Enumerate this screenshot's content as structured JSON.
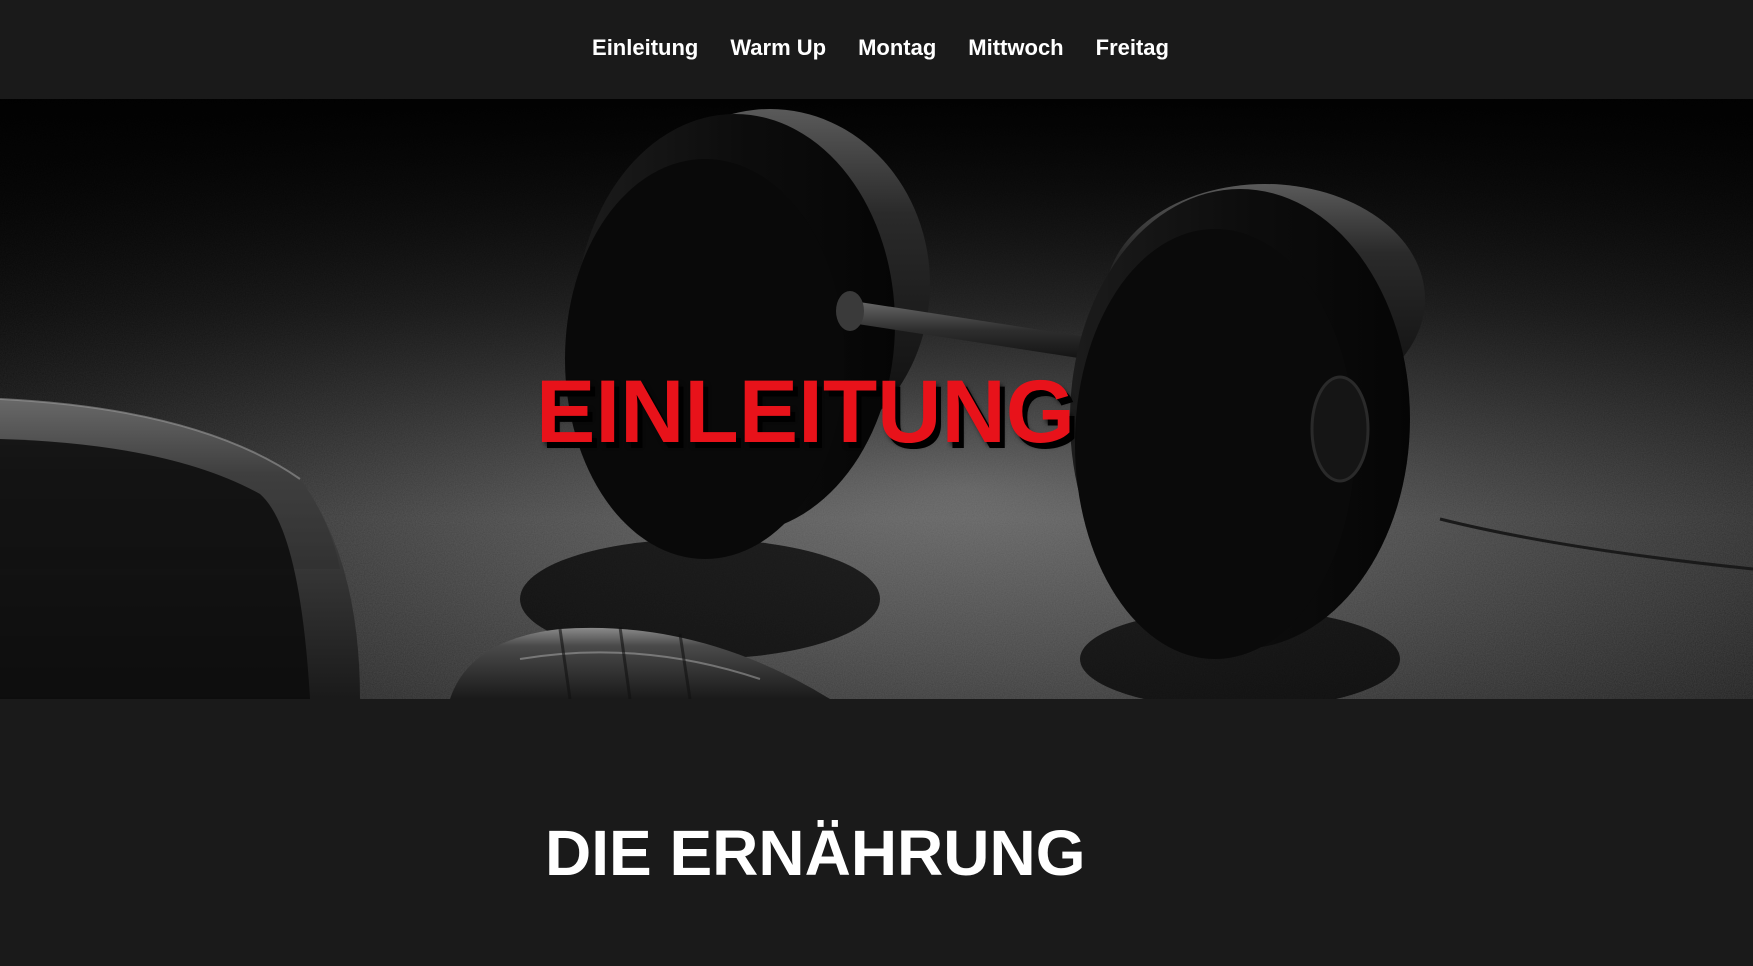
{
  "nav": {
    "items": [
      {
        "label": "Einleitung"
      },
      {
        "label": "Warm Up"
      },
      {
        "label": "Montag"
      },
      {
        "label": "Mittwoch"
      },
      {
        "label": "Freitag"
      }
    ]
  },
  "hero": {
    "title": "EINLEITUNG",
    "image_subject": "dumbbells-on-gym-floor-photo"
  },
  "section": {
    "heading": "DIE ERNÄHRUNG"
  },
  "colors": {
    "background": "#1a1a1a",
    "accent": "#e8121a",
    "text": "#ffffff"
  }
}
